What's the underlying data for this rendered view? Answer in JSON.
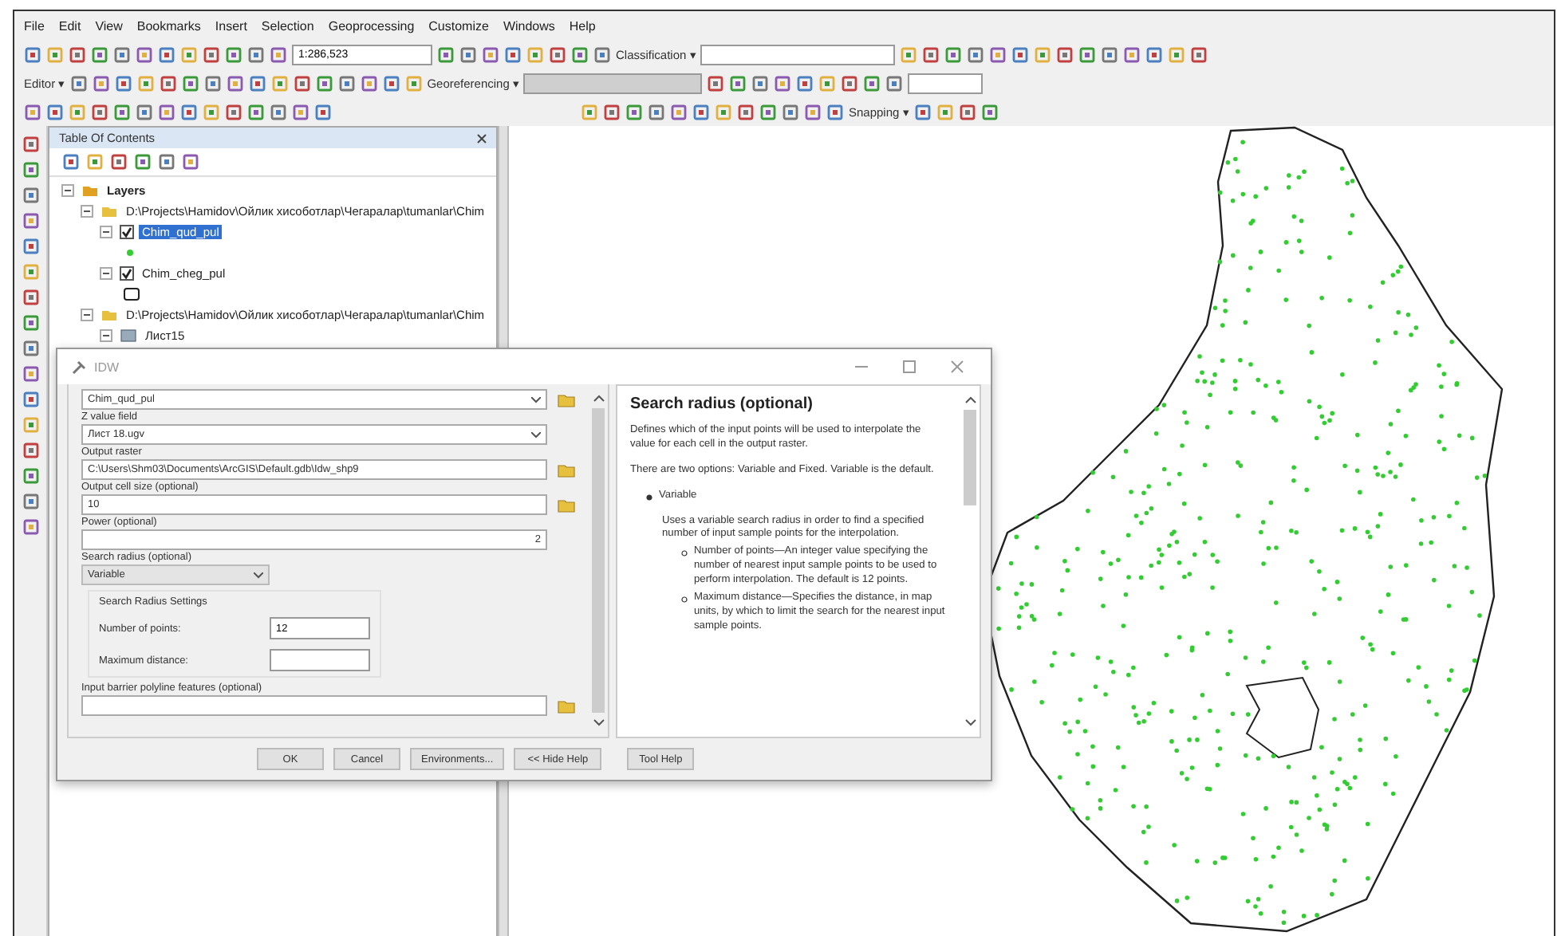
{
  "menu": [
    "File",
    "Edit",
    "View",
    "Bookmarks",
    "Insert",
    "Selection",
    "Geoprocessing",
    "Customize",
    "Windows",
    "Help"
  ],
  "toolbars": {
    "scale": "1:286,523",
    "classification": "Classification ▾",
    "editor": "Editor ▾",
    "georeferencing": "Georeferencing ▾",
    "snapping": "Snapping ▾"
  },
  "toc": {
    "title": "Table Of Contents",
    "tree": [
      {
        "label": "Layers",
        "kind": "frame",
        "children": [
          {
            "label": "D:\\Projects\\Hamidov\\Ойлик хисоботлар\\Чегаралар\\tumanlar\\Chim",
            "kind": "folder",
            "children": [
              {
                "label": "Chim_qud_pul",
                "kind": "point-layer",
                "checked": true,
                "selected": true
              },
              {
                "label": "Chim_cheg_pul",
                "kind": "polygon-layer",
                "checked": true,
                "selected": false
              }
            ]
          },
          {
            "label": "D:\\Projects\\Hamidov\\Ойлик хисоботлар\\Чегаралар\\tumanlar\\Chim",
            "kind": "folder",
            "children": [
              {
                "label": "Лист15",
                "kind": "table"
              }
            ]
          }
        ]
      }
    ]
  },
  "dialog": {
    "title": "IDW",
    "fields": [
      {
        "kind": "combo",
        "value": "Chim_qud_pul",
        "browse": true
      },
      {
        "kind": "combo",
        "label": "Z value field",
        "value": "Лист 18.ugv",
        "browse": false
      },
      {
        "kind": "text",
        "label": "Output raster",
        "value": "C:\\Users\\Shm03\\Documents\\ArcGIS\\Default.gdb\\Idw_shp9",
        "browse": true
      },
      {
        "kind": "text",
        "label": "Output cell size (optional)",
        "value": "10",
        "browse": true
      },
      {
        "kind": "number",
        "label": "Power (optional)",
        "value": "2",
        "browse": false
      },
      {
        "kind": "short-combo",
        "label": "Search radius (optional)",
        "value": "Variable",
        "browse": false
      },
      {
        "kind": "group",
        "label": "Search Radius Settings",
        "rows": [
          {
            "label": "Number of points:",
            "value": "12"
          },
          {
            "label": "Maximum distance:"
          }
        ]
      },
      {
        "kind": "text",
        "label": "Input barrier polyline features (optional)",
        "browse": true
      }
    ],
    "help": {
      "title": "Search radius (optional)",
      "blocks": [
        {
          "kind": "para",
          "text": "Defines which of the input points will be used to interpolate the value for each cell in the output raster."
        },
        {
          "kind": "para",
          "text": "There are two options: Variable and Fixed. Variable is the default."
        },
        {
          "kind": "bullet",
          "text": "Variable"
        },
        {
          "kind": "subpara",
          "text": "Uses a variable search radius in order to find a specified number of input sample points for the interpolation."
        },
        {
          "kind": "subbullet",
          "text": "Number of points—An integer value specifying the number of nearest input sample points to be used to perform interpolation. The default is 12 points."
        },
        {
          "kind": "subbullet",
          "text": "Maximum distance—Specifies the distance, in map units, by which to limit the search for the nearest input sample points."
        }
      ]
    },
    "buttons": [
      "OK",
      "Cancel",
      "Environments...",
      "<< Hide Help",
      "Tool Help"
    ]
  }
}
